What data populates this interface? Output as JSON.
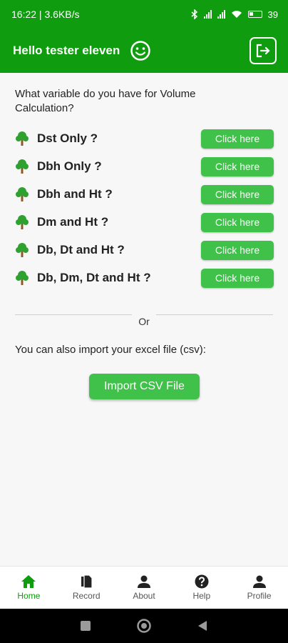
{
  "status_bar": {
    "time_speed": "16:22 | 3.6KB/s",
    "battery": "39"
  },
  "header": {
    "greeting": "Hello tester eleven"
  },
  "main": {
    "question": "What variable do you have for Volume Calculation?",
    "options": [
      {
        "label": "Dst Only ?",
        "button": "Click here"
      },
      {
        "label": "Dbh Only ?",
        "button": "Click here"
      },
      {
        "label": "Dbh and Ht ?",
        "button": "Click here"
      },
      {
        "label": "Dm and Ht ?",
        "button": "Click here"
      },
      {
        "label": "Db, Dt and Ht ?",
        "button": "Click here"
      },
      {
        "label": "Db, Dm, Dt and Ht ?",
        "button": "Click here"
      }
    ],
    "or_text": "Or",
    "import_text": "You can also import your excel file (csv):",
    "import_button": "Import CSV File"
  },
  "bottom_nav": [
    {
      "label": "Home",
      "icon": "home-icon",
      "active": true
    },
    {
      "label": "Record",
      "icon": "record-icon",
      "active": false
    },
    {
      "label": "About",
      "icon": "person-icon",
      "active": false
    },
    {
      "label": "Help",
      "icon": "help-icon",
      "active": false
    },
    {
      "label": "Profile",
      "icon": "profile-icon",
      "active": false
    }
  ],
  "colors": {
    "primary": "#0f9d0f",
    "button": "#3fc14a"
  }
}
